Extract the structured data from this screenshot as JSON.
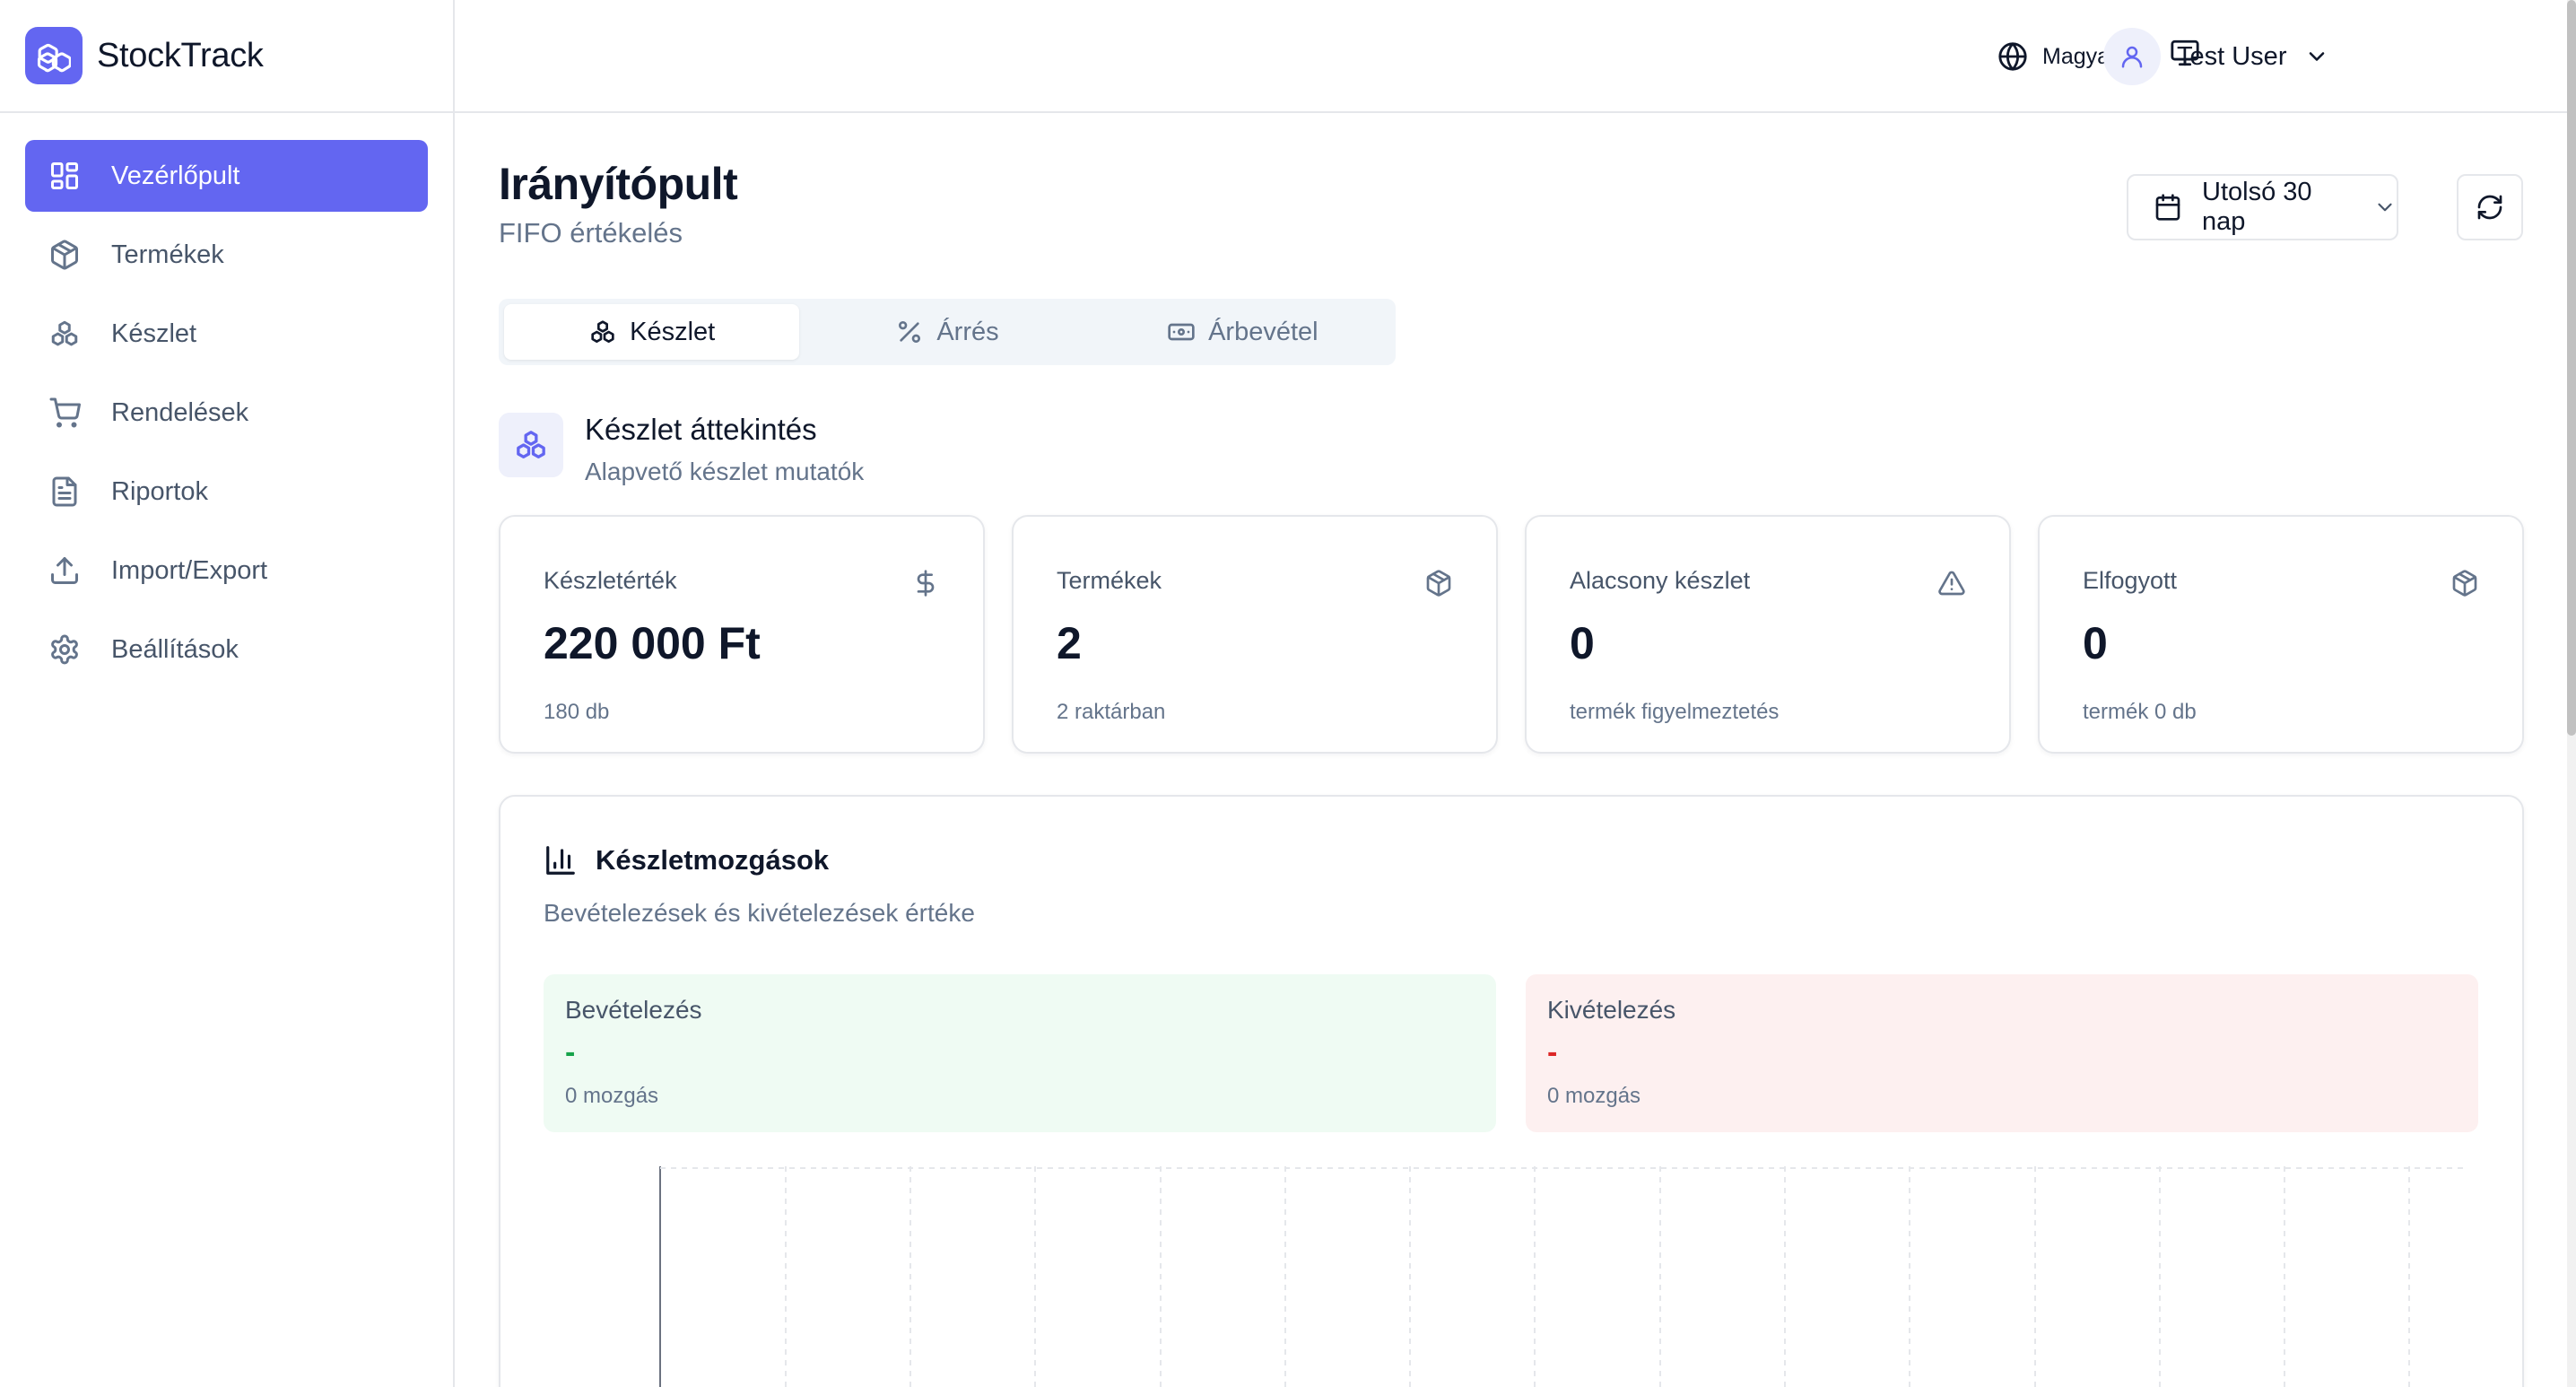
{
  "app": {
    "name": "StockTrack"
  },
  "colors": {
    "accent": "#6366f1",
    "positive": "#16a34a",
    "negative": "#dc2626"
  },
  "sidebar": {
    "items": [
      {
        "label": "Vezérlőpult",
        "icon": "dashboard-icon",
        "active": true
      },
      {
        "label": "Termékek",
        "icon": "package-icon"
      },
      {
        "label": "Készlet",
        "icon": "boxes-icon"
      },
      {
        "label": "Rendelések",
        "icon": "cart-icon"
      },
      {
        "label": "Riportok",
        "icon": "file-text-icon"
      },
      {
        "label": "Import/Export",
        "icon": "upload-icon"
      },
      {
        "label": "Beállítások",
        "icon": "gear-icon"
      }
    ]
  },
  "header": {
    "language": "Magyar",
    "user_name": "Test User"
  },
  "page": {
    "title": "Irányítópult",
    "subtitle": "FIFO értékelés",
    "date_range": "Utolsó 30 nap"
  },
  "tabs": [
    {
      "label": "Készlet",
      "active": true
    },
    {
      "label": "Árrés"
    },
    {
      "label": "Árbevétel"
    }
  ],
  "section": {
    "title": "Készlet áttekintés",
    "subtitle": "Alapvető készlet mutatók"
  },
  "cards": [
    {
      "label": "Készletérték",
      "value": "220 000 Ft",
      "sub": "180 db",
      "icon": "dollar-icon"
    },
    {
      "label": "Termékek",
      "value": "2",
      "sub": "2 raktárban",
      "icon": "package-icon"
    },
    {
      "label": "Alacsony készlet",
      "value": "0",
      "sub": "termék figyelmeztetés",
      "icon": "warning-icon"
    },
    {
      "label": "Elfogyott",
      "value": "0",
      "sub": "termék 0 db",
      "icon": "package-icon"
    }
  ],
  "movements": {
    "title": "Készletmozgások",
    "subtitle": "Bevételezések és kivételezések értéke",
    "incoming": {
      "label": "Bevételezés",
      "value": "-",
      "sub": "0 mozgás"
    },
    "outgoing": {
      "label": "Kivételezés",
      "value": "-",
      "sub": "0 mozgás"
    }
  }
}
